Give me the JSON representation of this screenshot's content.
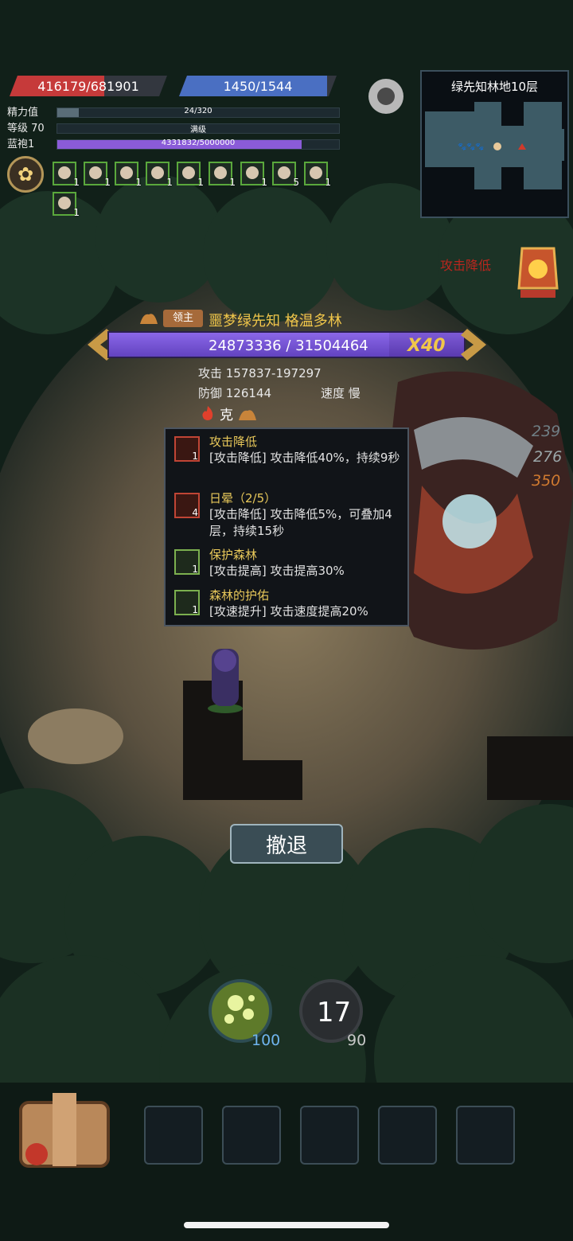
{
  "player": {
    "hp": "416179/681901",
    "mp": "1450/1544",
    "energy_label": "精力值",
    "energy_value": "24/320",
    "energy_fraction": 0.075,
    "level_label": "等级 70",
    "level_value": "满级",
    "robe_label": "蓝袍1",
    "robe_value": "4331832/5000000",
    "robe_fraction": 0.866
  },
  "buffs": [
    {
      "icon": "star-medal-icon",
      "count": "1"
    },
    {
      "icon": "star-medal-icon",
      "count": "1"
    },
    {
      "icon": "star-medal-icon",
      "count": "1"
    },
    {
      "icon": "star-medal-icon",
      "count": "1"
    },
    {
      "icon": "star-medal-icon",
      "count": "1"
    },
    {
      "icon": "shield-cup-icon",
      "count": "1"
    },
    {
      "icon": "egg-icon",
      "count": "1"
    },
    {
      "icon": "portrait-icon",
      "count": "5"
    },
    {
      "icon": "shield-icon",
      "count": "1"
    },
    {
      "icon": "shield-cup-icon",
      "count": "1"
    }
  ],
  "minimap": {
    "title": "绿先知林地10层"
  },
  "status_floating": "攻击降低",
  "boss": {
    "tag": "领主",
    "name": "噩梦绿先知 格温多林",
    "hp_text": "24873336 / 31504464",
    "hp_fraction": 0.79,
    "multiplier": "X40",
    "attack": "攻击 157837-197297",
    "defense": "防御 126144",
    "speed": "速度 慢",
    "counter": "克"
  },
  "tooltip": {
    "entries": [
      {
        "icon": "attack-down-icon",
        "stack": "1",
        "title": "攻击降低",
        "desc": "[攻击降低] 攻击降低40%，持续9秒",
        "color": "red"
      },
      {
        "icon": "attack-down-icon",
        "stack": "4",
        "title": "日晕（2/5）",
        "desc": "[攻击降低] 攻击降低5%，可叠加4层，持续15秒",
        "color": "red"
      },
      {
        "icon": "sword-up-icon",
        "stack": "1",
        "title": "保护森林",
        "desc": "[攻击提高] 攻击提高30%",
        "color": "green"
      },
      {
        "icon": "speed-up-icon",
        "stack": "1",
        "title": "森林的护佑",
        "desc": "[攻速提升] 攻击速度提高20%",
        "color": "green"
      }
    ]
  },
  "damage_numbers": [
    "239",
    "276",
    "350"
  ],
  "retreat_label": "撤退",
  "skills": {
    "orb_count": "100",
    "shield_number": "17",
    "shield_count": "90"
  },
  "colors": {
    "hp": "#c63a3a",
    "mp": "#4a6fc2",
    "robe": "#8a5bd8",
    "boss_bar": "#6a49c6",
    "accent_gold": "#f0c64a"
  }
}
